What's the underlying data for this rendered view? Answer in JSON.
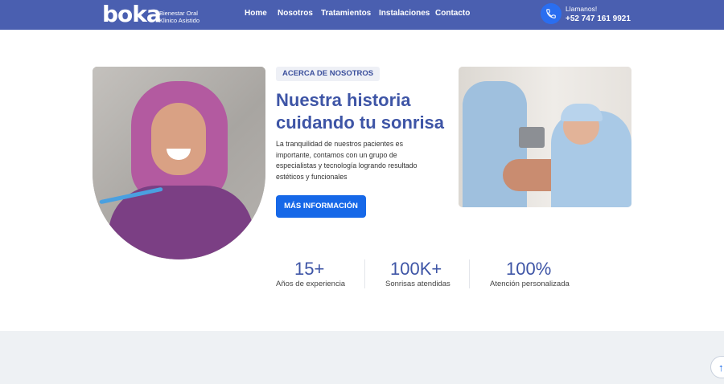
{
  "brand": {
    "logo": "boka",
    "tagline_line1": "Bienestar Oral",
    "tagline_line2": "Klinico Asistido"
  },
  "nav": {
    "home": "Home",
    "about": "Nosotros",
    "treatments": "Tratamientos",
    "facilities": "Instalaciones",
    "contact": "Contacto"
  },
  "contact": {
    "label": "Llamanos!",
    "phone": "+52 747 161 9921",
    "icon": "phone-icon"
  },
  "about": {
    "badge": "ACERCA DE NOSOTROS",
    "title_line1": "Nuestra historia",
    "title_line2": "cuidando tu sonrisa",
    "description": "La tranquilidad de nuestros pacientes es importante, contamos con un grupo de especialistas y tecnología logrando resultado estéticos y funcionales",
    "cta": "MÁS INFORMACIÓN"
  },
  "stats": [
    {
      "value": "15+",
      "label": "Años de experiencia"
    },
    {
      "value": "100K+",
      "label": "Sonrisas atendidas"
    },
    {
      "value": "100%",
      "label": "Atención personalizada"
    }
  ],
  "colors": {
    "header": "#4a5fb0",
    "accent": "#1668e8",
    "heading": "#3e55a6"
  },
  "scroll_top_icon": "arrow-up-icon"
}
